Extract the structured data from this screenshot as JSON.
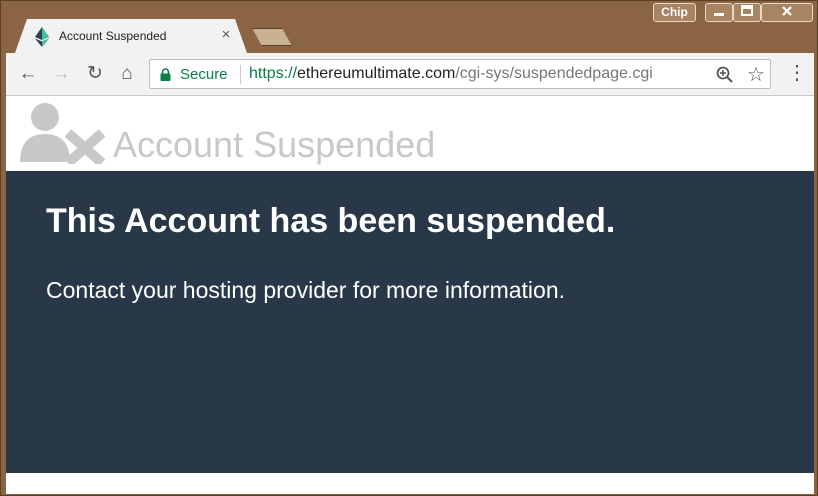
{
  "browser": {
    "tab": {
      "title": "Account Suspended",
      "close_glyph": "×"
    },
    "profile_label": "Chip",
    "window_controls": {
      "minimize": "—",
      "maximize": "▢",
      "close": "✕"
    },
    "toolbar": {
      "back_glyph": "←",
      "forward_glyph": "→",
      "reload_glyph": "↻",
      "home_glyph": "⌂",
      "star_glyph": "☆",
      "menu_glyph": "⋮"
    },
    "omnibox": {
      "secure_label": "Secure",
      "url_scheme": "https://",
      "url_host": "ethereumultimate.com",
      "url_path": "/cgi-sys/suspendedpage.cgi"
    }
  },
  "page": {
    "header_title": "Account Suspended",
    "heading": "This Account has been suspended.",
    "message": "Contact your hosting provider for more information."
  },
  "colors": {
    "frame": "#8b6443",
    "panel_bg": "#283849",
    "secure_green": "#0b8043",
    "header_gray": "#c8c8c8"
  },
  "icons": [
    "ethereum-favicon-icon",
    "close-icon",
    "new-tab-icon",
    "back-arrow-icon",
    "forward-arrow-icon",
    "reload-icon",
    "home-icon",
    "lock-icon",
    "zoom-icon",
    "star-icon",
    "menu-icon",
    "user-x-icon"
  ]
}
